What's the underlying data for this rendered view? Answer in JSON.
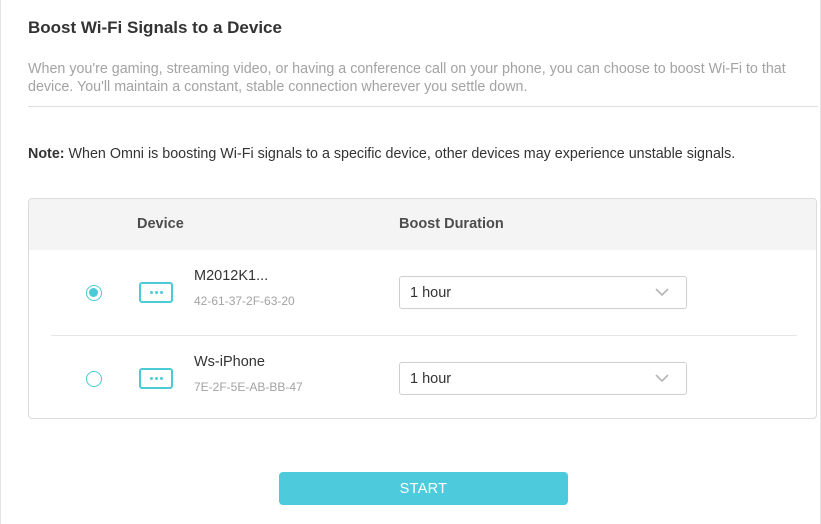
{
  "section": {
    "title": "Boost Wi-Fi Signals to a Device",
    "description": "When you're gaming, streaming video, or having a conference call on your phone, you can choose to boost Wi-Fi to that device. You'll maintain a constant, stable connection wherever you settle down.",
    "note_label": "Note:",
    "note_text": " When Omni is boosting Wi-Fi signals to a specific device, other devices may experience unstable signals."
  },
  "table": {
    "headers": {
      "device": "Device",
      "duration": "Boost Duration"
    },
    "rows": [
      {
        "selected": true,
        "icon": "device-icon",
        "name": "M2012K1...",
        "mac": "42-61-37-2F-63-20",
        "duration": "1 hour"
      },
      {
        "selected": false,
        "icon": "device-icon",
        "name": "Ws-iPhone",
        "mac": "7E-2F-5E-AB-BB-47",
        "duration": "1 hour"
      }
    ]
  },
  "actions": {
    "start_label": "START"
  },
  "colors": {
    "accent": "#4acbd6",
    "button": "#4dcadc"
  }
}
